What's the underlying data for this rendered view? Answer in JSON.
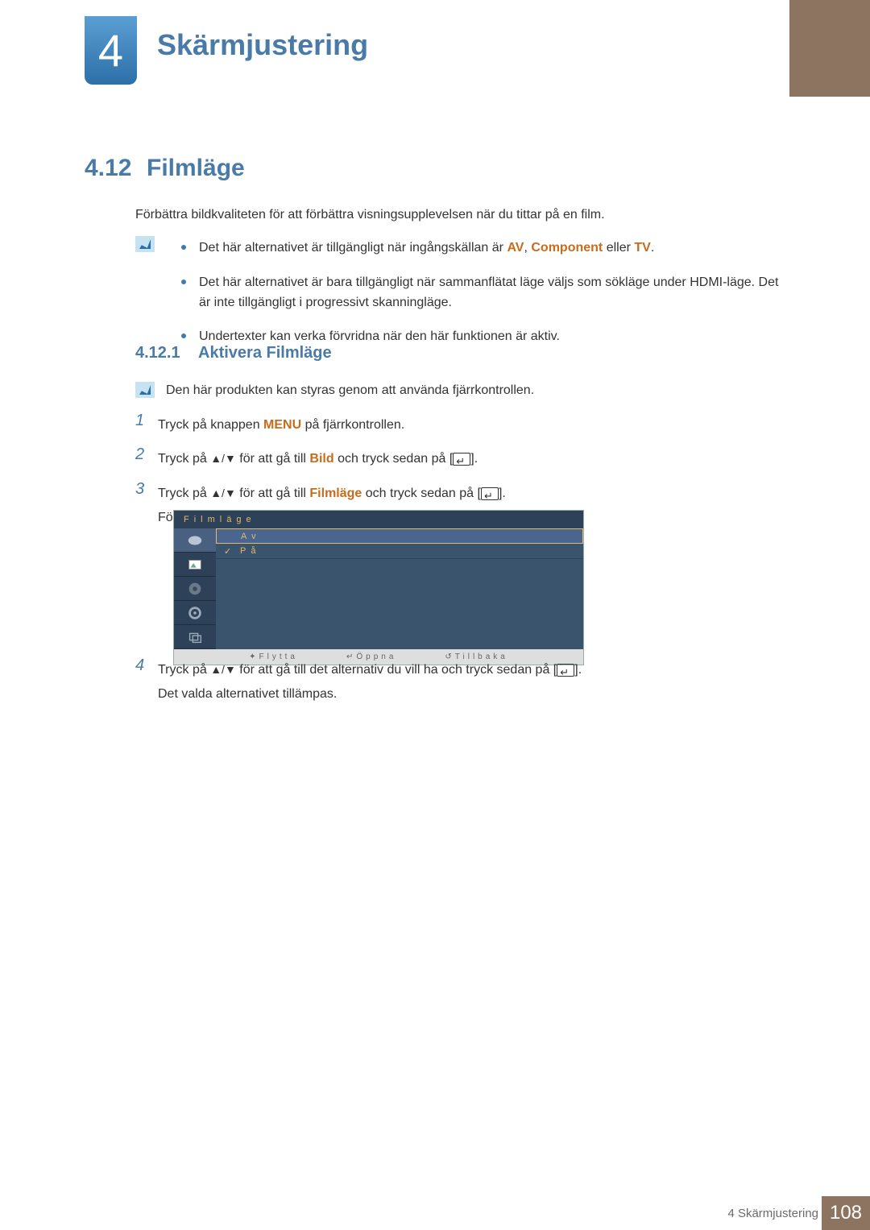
{
  "chapter": {
    "number": "4",
    "title": "Skärmjustering"
  },
  "section": {
    "number": "4.12",
    "title": "Filmläge"
  },
  "intro": "Förbättra bildkvaliteten för att förbättra visningsupplevelsen när du tittar på en film.",
  "bullets": [
    {
      "pre": "Det här alternativet är tillgängligt när ingångskällan är ",
      "h1": "AV",
      "mid1": ", ",
      "h2": "Component",
      "mid2": " eller ",
      "h3": "TV",
      "post": "."
    },
    {
      "text": "Det här alternativet är bara tillgängligt när sammanflätat läge väljs som sökläge under HDMI-läge. Det är inte tillgängligt i progressivt skanningläge."
    },
    {
      "text": "Undertexter kan verka förvridna när den här funktionen är aktiv."
    }
  ],
  "subsection": {
    "number": "4.12.1",
    "title": "Aktivera Filmläge"
  },
  "remote_note": "Den här produkten kan styras genom att använda fjärrkontrollen.",
  "steps": {
    "s1": {
      "num": "1",
      "pre": "Tryck på knappen ",
      "hl": "MENU",
      "post": " på fjärrkontrollen."
    },
    "s2": {
      "num": "2",
      "pre": "Tryck på ",
      "mid": " för att gå till ",
      "hl": "Bild",
      "post": " och tryck sedan på [",
      "end": "]."
    },
    "s3": {
      "num": "3",
      "pre": "Tryck på ",
      "mid": " för att gå till ",
      "hl": "Filmläge",
      "post": " och tryck sedan på [",
      "end": "].",
      "after": "Följande skärm visas."
    },
    "s4": {
      "num": "4",
      "pre": "Tryck på ",
      "mid": " för att gå till det alternativ du vill ha och tryck sedan på [",
      "end": "].",
      "after": "Det valda alternativet tillämpas."
    }
  },
  "osd": {
    "title": "Filmläge",
    "options": {
      "off": "Av",
      "on": "På"
    },
    "footer": {
      "move": "Flytta",
      "open": "Öppna",
      "back": "Tillbaka"
    }
  },
  "footer": {
    "label": "4 Skärmjustering",
    "page": "108"
  }
}
